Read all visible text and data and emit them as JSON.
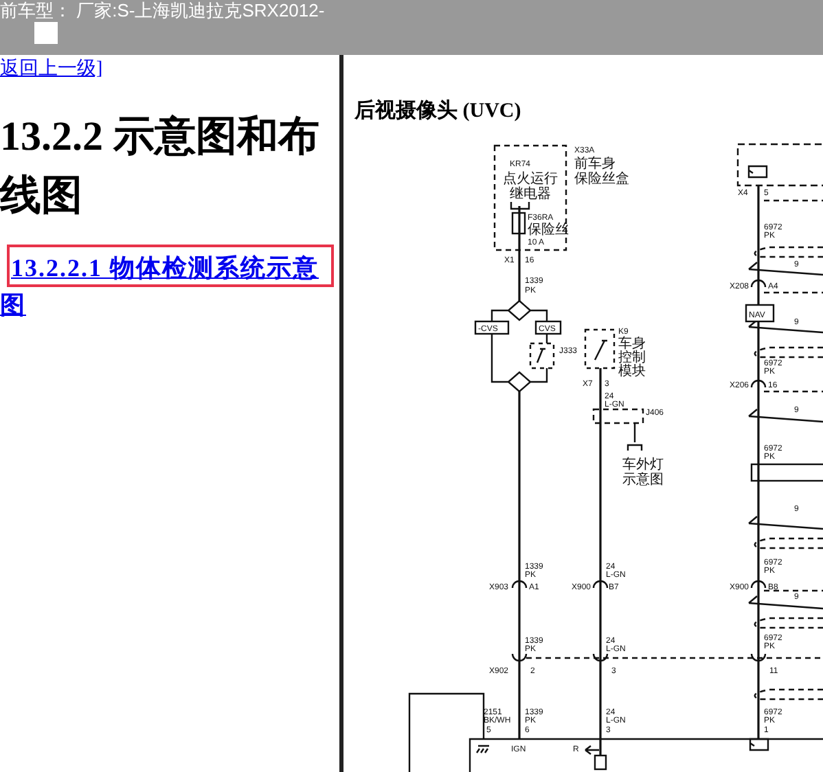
{
  "top_bar": {
    "model_text": "前车型：  厂家:S-上海凯迪拉克SRX2012-"
  },
  "nav": {
    "back_link": "返回上一级]"
  },
  "section": {
    "heading": "13.2.2 示意图和布线图",
    "links": [
      {
        "label": "13.2.2.1 物体检测系统示意图",
        "focused": true
      }
    ]
  },
  "diagram": {
    "title": "后视摄像头 (UVC)",
    "labels": [
      "X33A",
      "前车身",
      "保险丝盒",
      "KR74",
      "点火运行",
      "继电器",
      "F36RA",
      "保险丝",
      "10 A",
      "X1",
      "16",
      "1339",
      "PK",
      "-CVS",
      "CVS",
      "J333",
      "K9",
      "车身",
      "控制",
      "模块",
      "X7",
      "3",
      "24",
      "L-GN",
      "J406",
      "车外灯",
      "示意图",
      "1339",
      "PK",
      "X903",
      "A1",
      "24",
      "L-GN",
      "X900",
      "B7",
      "1339",
      "PK",
      "X902",
      "2",
      "24",
      "L-GN",
      "3",
      "2151",
      "BK/WH",
      "5",
      "1339",
      "PK",
      "6",
      "24",
      "L-GN",
      "3",
      "IGN",
      "R",
      "X4",
      "5",
      "6972",
      "PK",
      "9",
      "X208",
      "A4",
      "NAV",
      "9",
      "6972",
      "PK",
      "X206",
      "16",
      "9",
      "6972",
      "PK",
      "9",
      "6972",
      "PK",
      "X900",
      "B8",
      "9",
      "6972",
      "PK",
      "11",
      "6972",
      "PK",
      "1"
    ]
  }
}
